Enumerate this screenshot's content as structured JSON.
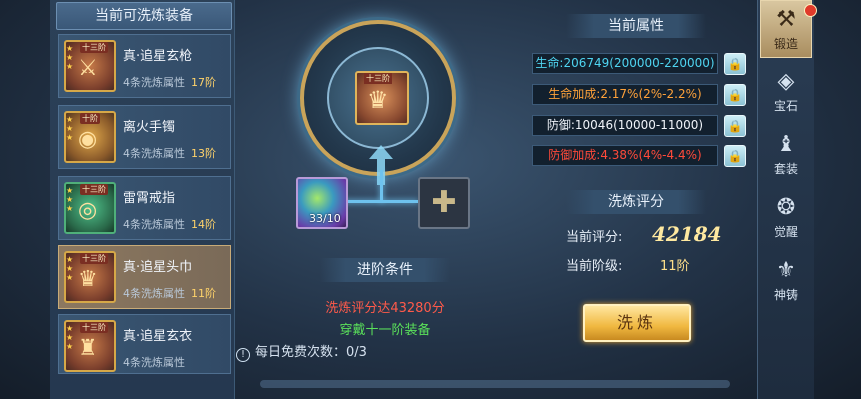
{
  "left_panel": {
    "title": "当前可洗炼装备",
    "items": [
      {
        "name": "真·追星玄枪",
        "attr": "4条洗炼属性",
        "tier": "17阶",
        "badge": "十三阶",
        "selected": false
      },
      {
        "name": "离火手镯",
        "attr": "4条洗炼属性",
        "tier": "13阶",
        "badge": "十阶",
        "selected": false
      },
      {
        "name": "雷霄戒指",
        "attr": "4条洗炼属性",
        "tier": "14阶",
        "badge": "十三阶",
        "selected": false
      },
      {
        "name": "真·追星头巾",
        "attr": "4条洗炼属性",
        "tier": "11阶",
        "badge": "十三阶",
        "selected": true
      },
      {
        "name": "真·追星玄衣",
        "attr": "4条洗炼属性",
        "tier": "",
        "badge": "十三阶",
        "selected": false
      }
    ]
  },
  "center": {
    "equipped_badge": "十三阶",
    "material_count": "33/10",
    "advance_title": "进阶条件",
    "condition_1": "洗炼评分达43280分",
    "condition_2": "穿戴十一阶装备",
    "free_times": "每日免费次数：0/3"
  },
  "attributes": {
    "title": "当前属性",
    "rows": [
      {
        "text": "生命:206749(200000-220000)",
        "color": "cyan"
      },
      {
        "text": "生命加成:2.17%(2%-2.2%)",
        "color": "orange"
      },
      {
        "text": "防御:10046(10000-11000)",
        "color": "white"
      },
      {
        "text": "防御加成:4.38%(4%-4.4%)",
        "color": "red"
      }
    ]
  },
  "score": {
    "title": "洗炼评分",
    "current_score_label": "当前评分:",
    "current_score": "42184",
    "current_tier_label": "当前阶级:",
    "current_tier": "11阶"
  },
  "refine_button": "洗炼",
  "side_nav": [
    {
      "label": "锻造",
      "icon": "anvil-icon",
      "active": true
    },
    {
      "label": "宝石",
      "icon": "gem-icon",
      "active": false
    },
    {
      "label": "套装",
      "icon": "armor-set-icon",
      "active": false
    },
    {
      "label": "觉醒",
      "icon": "awaken-icon",
      "active": false
    },
    {
      "label": "神铸",
      "icon": "divine-forge-icon",
      "active": false
    }
  ]
}
